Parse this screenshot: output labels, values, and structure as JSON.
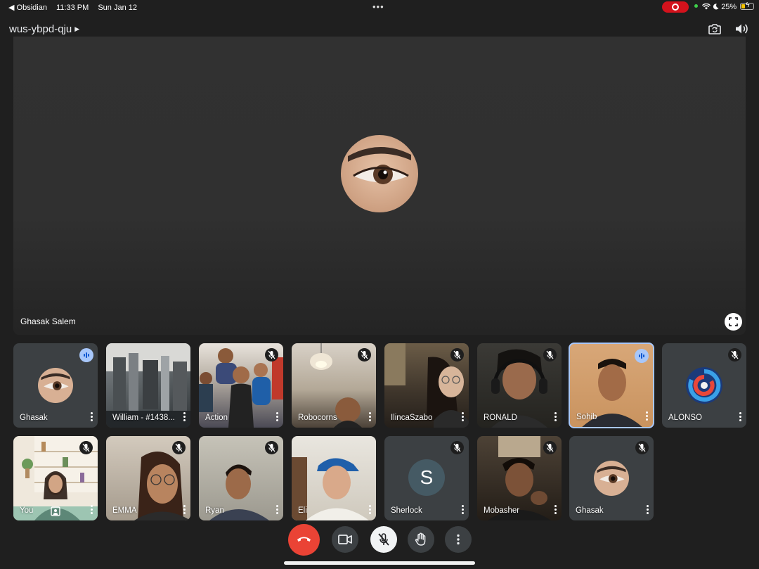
{
  "status_bar": {
    "back_app": "Obsidian",
    "time": "11:33 PM",
    "date": "Sun Jan 12",
    "battery": "25%"
  },
  "header": {
    "meeting_code": "wus-ybpd-qju"
  },
  "stage": {
    "name": "Ghasak Salem"
  },
  "tiles": [
    {
      "name": "Ghasak"
    },
    {
      "name": "William - #1438..."
    },
    {
      "name": "Action"
    },
    {
      "name": "Robocorns"
    },
    {
      "name": "IlincaSzabo"
    },
    {
      "name": "RONALD"
    },
    {
      "name": "Sohib"
    },
    {
      "name": "ALONSO"
    },
    {
      "name": "You"
    },
    {
      "name": "EMMA"
    },
    {
      "name": "Ryan"
    },
    {
      "name": "Eli"
    },
    {
      "name": "Sherlock",
      "initial": "S"
    },
    {
      "name": "Mobasher"
    },
    {
      "name": "Ghasak"
    }
  ],
  "colors": {
    "background": "#1f1f1f",
    "end_call": "#ea4335",
    "active_speaker": "#a8c7fa",
    "recording": "#d3121c"
  }
}
